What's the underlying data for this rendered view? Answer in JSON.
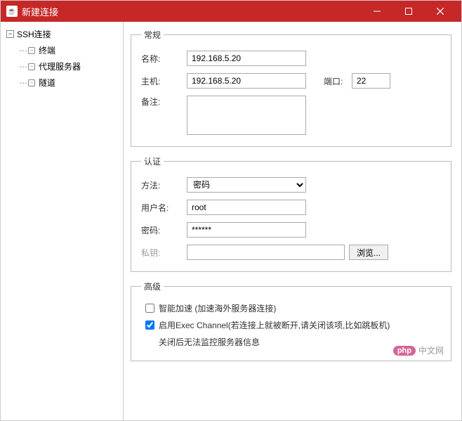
{
  "window": {
    "title": "新建连接"
  },
  "sidebar": {
    "items": [
      {
        "label": "SSH连接",
        "type": "root"
      },
      {
        "label": "终端",
        "type": "child"
      },
      {
        "label": "代理服务器",
        "type": "child"
      },
      {
        "label": "隧道",
        "type": "child"
      }
    ]
  },
  "general": {
    "legend": "常规",
    "name_label": "名称:",
    "name_value": "192.168.5.20",
    "host_label": "主机:",
    "host_value": "192.168.5.20",
    "port_label": "端口:",
    "port_value": "22",
    "remark_label": "备注:",
    "remark_value": ""
  },
  "auth": {
    "legend": "认证",
    "method_label": "方法:",
    "method_value": "密码",
    "username_label": "用户名:",
    "username_value": "root",
    "password_label": "密码:",
    "password_value": "******",
    "privkey_label": "私钥:",
    "privkey_value": "",
    "browse_label": "浏览..."
  },
  "advanced": {
    "legend": "高级",
    "accel_label": "智能加速 (加速海外服务器连接)",
    "accel_checked": false,
    "exec_label": "启用Exec Channel(若连接上就被断开,请关闭该项,比如跳板机)",
    "exec_note": "关闭后无法监控服务器信息",
    "exec_checked": true
  },
  "watermark": {
    "logo": "php",
    "text": "中文网"
  }
}
